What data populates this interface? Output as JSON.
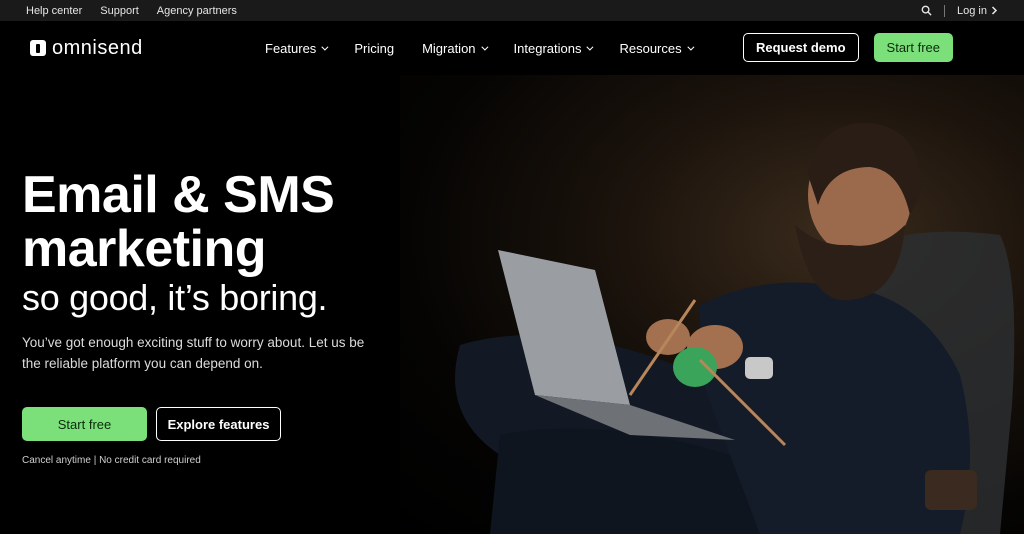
{
  "topbar": {
    "links": [
      "Help center",
      "Support",
      "Agency partners"
    ],
    "login": "Log in"
  },
  "brand": {
    "name": "omnisend"
  },
  "nav": {
    "items": [
      {
        "label": "Features",
        "dropdown": true
      },
      {
        "label": "Pricing",
        "dropdown": false
      },
      {
        "label": "Migration",
        "dropdown": true
      },
      {
        "label": "Integrations",
        "dropdown": true
      },
      {
        "label": "Resources",
        "dropdown": true
      }
    ],
    "request_demo": "Request demo",
    "start_free": "Start free"
  },
  "hero": {
    "headline_line1": "Email & SMS",
    "headline_line2": "marketing",
    "subheadline": "so good, it’s boring.",
    "description": "You’ve got enough exciting stuff to worry about. Let us be the reliable platform you can depend on.",
    "cta_primary": "Start free",
    "cta_secondary": "Explore features",
    "note": "Cancel anytime | No credit card required"
  },
  "colors": {
    "accent_green": "#7be07a",
    "background": "#000000",
    "topbar": "#1a1a1a"
  },
  "icons": [
    "search-icon",
    "chevron-right-icon",
    "chevron-down-icon",
    "logo-icon"
  ]
}
